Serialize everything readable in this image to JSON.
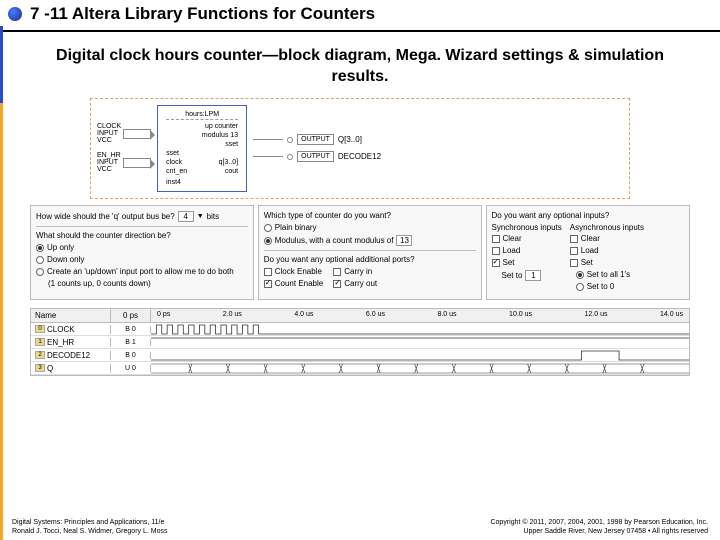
{
  "title": "7 -11 Altera Library Functions for Counters",
  "subtitle": "Digital clock hours counter—block diagram, Mega. Wizard settings & simulation results.",
  "diagram": {
    "label_lpm": "hours:LPM",
    "desc1": "up counter",
    "desc2": "modulus 13",
    "desc3": "sset",
    "in1_name": "CLOCK",
    "in1_type": "INPUT",
    "in1_vcc": "VCC",
    "in2_name": "EN_HR",
    "in2_type": "INPUT",
    "in2_vcc": "VCC",
    "port_sset": "sset",
    "port_clock": "clock",
    "port_cnten": "cnt_en",
    "port_q": "q[3..0]",
    "port_cout": "cout",
    "inst": "inst4",
    "out1_type": "OUTPUT",
    "out1_name": "Q[3..0]",
    "out2_type": "OUTPUT",
    "out2_name": "DECODE12"
  },
  "settings": {
    "p1": {
      "q1": "How wide should the 'q' output bus be?",
      "bits_val": "4",
      "bits_unit": "bits",
      "q2": "What should the counter direction be?",
      "opt1": "Up only",
      "opt2": "Down only",
      "opt3": "Create an 'up/down' input port to allow me to do both",
      "opt3_sub": "(1 counts up, 0 counts down)"
    },
    "p2": {
      "q1": "Which type of counter do you want?",
      "opt1": "Plain binary",
      "opt2": "Modulus, with a count modulus of",
      "mod_val": "13",
      "q2": "Do you want any optional additional ports?",
      "c1": "Clock Enable",
      "c2": "Count Enable",
      "c3": "Carry in",
      "c4": "Carry out"
    },
    "p3": {
      "q1": "Do you want any optional inputs?",
      "h1": "Synchronous inputs",
      "h2": "Asynchronous inputs",
      "s_clear": "Clear",
      "s_load": "Load",
      "s_set": "Set",
      "s_setto": "Set to",
      "s_setval": "1",
      "a_clear": "Clear",
      "a_load": "Load",
      "a_set": "Set",
      "r1": "Set to all 1's",
      "r2": "Set to 0"
    }
  },
  "sim": {
    "col_name": "Name",
    "col_val_hdr": "0 ps",
    "times": [
      "0 ps",
      "2.0 us",
      "4.0 us",
      "6.0 us",
      "8.0 us",
      "10.0 us",
      "12.0 us",
      "14.0 us"
    ],
    "rows": [
      {
        "name": "CLOCK",
        "val": "B 0"
      },
      {
        "name": "EN_HR",
        "val": "B 1"
      },
      {
        "name": "DECODE12",
        "val": "B 0"
      },
      {
        "name": "Q",
        "val": "U 0"
      }
    ]
  },
  "footer": {
    "left1": "Digital Systems: Principles and Applications, 11/e",
    "left2": "Ronald J. Tocci, Neal S. Widmer, Gregory L. Moss",
    "right1": "Copyright © 2011, 2007, 2004, 2001, 1998 by Pearson Education, Inc.",
    "right2": "Upper Saddle River, New Jersey 07458 • All rights reserved"
  }
}
